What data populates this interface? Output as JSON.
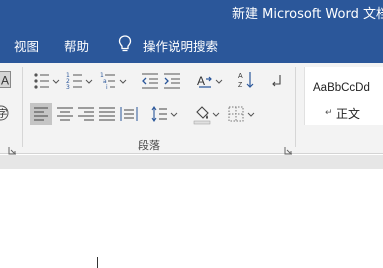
{
  "window": {
    "title": "新建 Microsoft Word 文档"
  },
  "tabs": [
    {
      "label": "视图"
    },
    {
      "label": "帮助"
    }
  ],
  "tell_me": {
    "label": "操作说明搜索",
    "icon": "lightbulb-icon"
  },
  "ribbon": {
    "paragraph_group": {
      "label": "段落"
    },
    "styles": {
      "preview_text": "AaBbCcDd",
      "style_name": "正文",
      "paragraph_mark": "↵"
    }
  },
  "colors": {
    "title_bar": "#2b579a",
    "ribbon": "#f3f3f3",
    "active_button": "#c5c5c5"
  }
}
